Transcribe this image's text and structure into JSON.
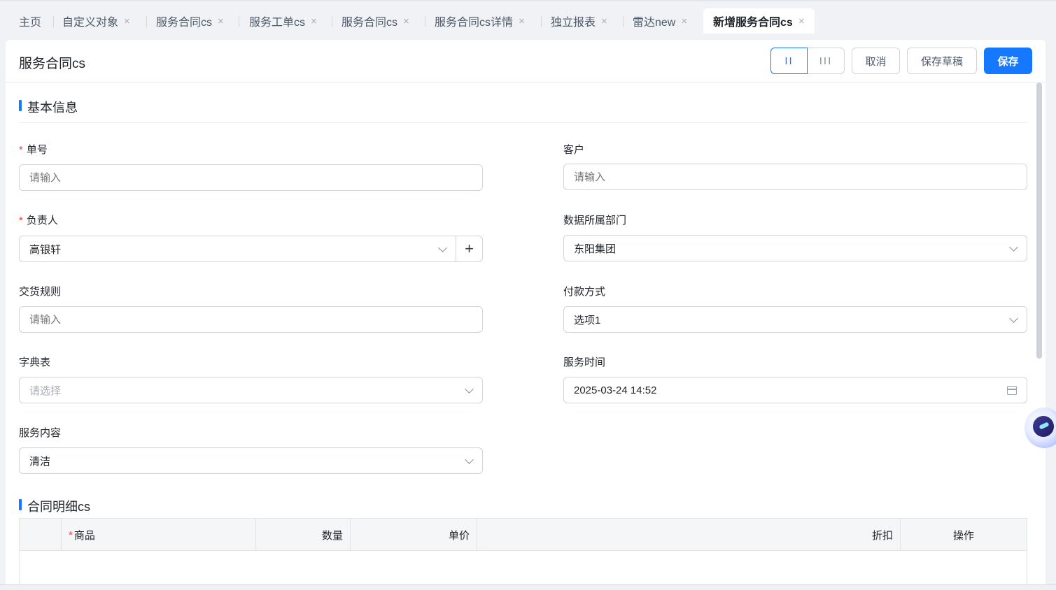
{
  "tabs": [
    {
      "label": "主页",
      "closable": false
    },
    {
      "label": "自定义对象",
      "closable": true
    },
    {
      "label": "服务合同cs",
      "closable": true
    },
    {
      "label": "服务工单cs",
      "closable": true
    },
    {
      "label": "服务合同cs",
      "closable": true
    },
    {
      "label": "服务合同cs详情",
      "closable": true
    },
    {
      "label": "独立报表",
      "closable": true
    },
    {
      "label": "雷达new",
      "closable": true
    },
    {
      "label": "新增服务合同cs",
      "closable": true,
      "active": true
    }
  ],
  "close_glyph": "×",
  "header": {
    "title": "服务合同cs",
    "layout_two": "II",
    "layout_three": "III",
    "cancel": "取消",
    "save_draft": "保存草稿",
    "save": "保存"
  },
  "basic": {
    "title": "基本信息",
    "order_no": {
      "label": "单号",
      "required": true,
      "placeholder": "请输入",
      "value": ""
    },
    "customer": {
      "label": "客户",
      "required": false,
      "placeholder": "请输入",
      "value": ""
    },
    "owner": {
      "label": "负责人",
      "required": true,
      "value": "高银轩"
    },
    "department": {
      "label": "数据所属部门",
      "value": "东阳集团"
    },
    "delivery_rule": {
      "label": "交货规则",
      "placeholder": "请输入",
      "value": ""
    },
    "payment": {
      "label": "付款方式",
      "value": "选项1"
    },
    "dictionary": {
      "label": "字典表",
      "placeholder": "请选择",
      "value": ""
    },
    "service_time": {
      "label": "服务时间",
      "value": "2025-03-24 14:52"
    },
    "service_content": {
      "label": "服务内容",
      "value": "清洁"
    }
  },
  "detail": {
    "title": "合同明细cs",
    "columns": {
      "product": "商品",
      "quantity": "数量",
      "unit_price": "单价",
      "discount": "折扣",
      "action": "操作"
    }
  },
  "colors": {
    "accent": "#1677ff",
    "required": "#f53f3f"
  },
  "icons": [
    "close-icon",
    "chevron-down-icon",
    "plus-icon",
    "calendar-icon",
    "assistant-icon"
  ]
}
